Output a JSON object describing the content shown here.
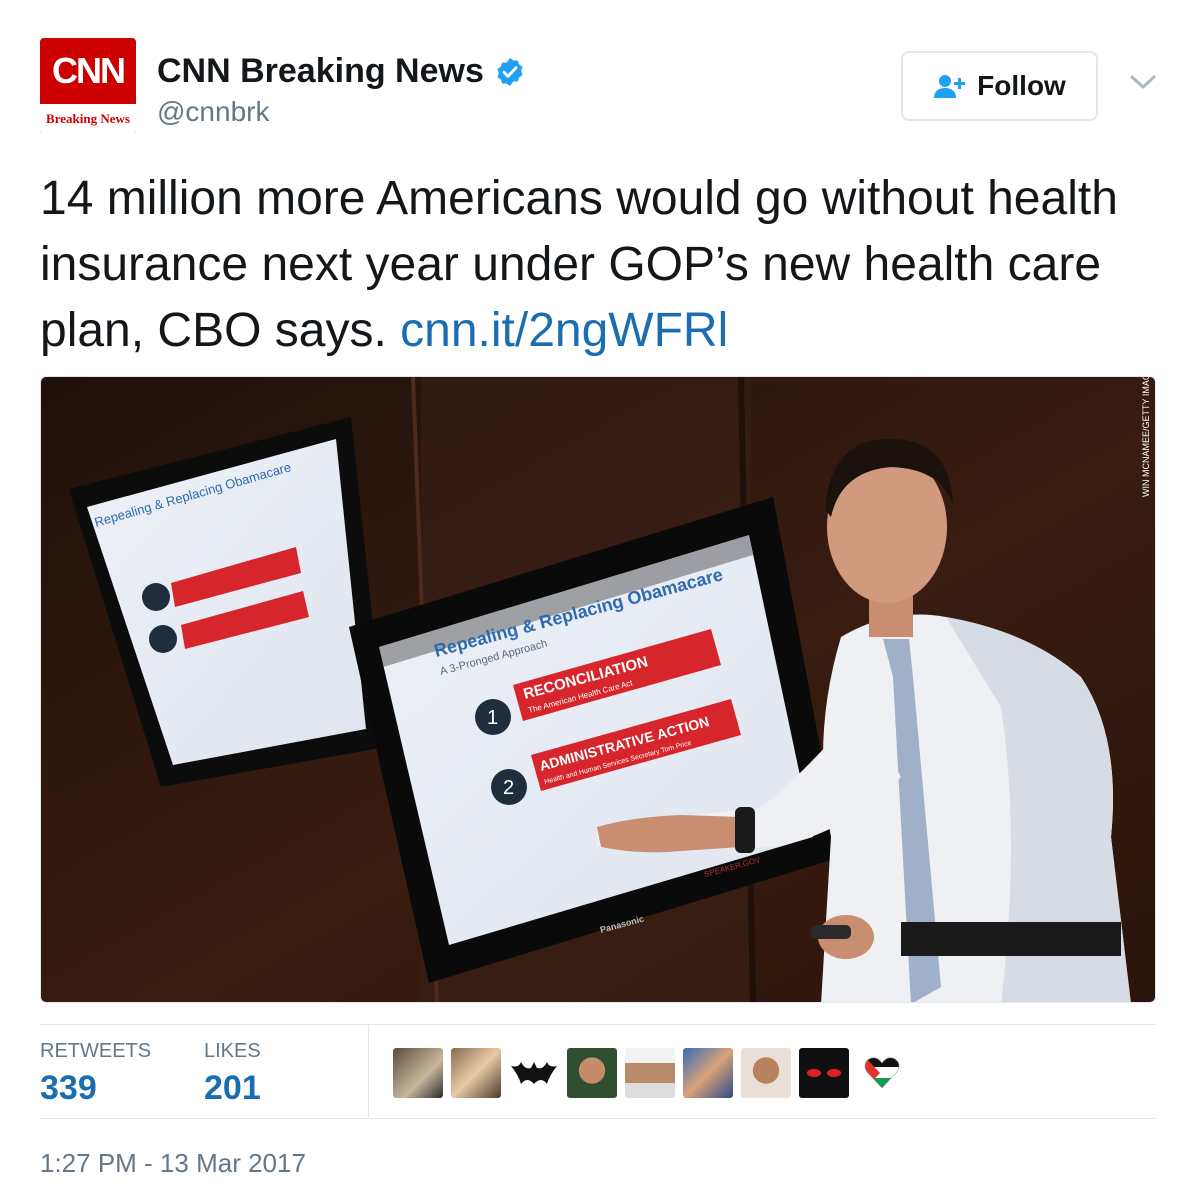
{
  "account": {
    "display_name": "CNN Breaking News",
    "handle": "@cnnbrk",
    "avatar_logo": "CNN",
    "avatar_caption": "Breaking News",
    "verified_icon": "verified-badge-icon"
  },
  "follow": {
    "label": "Follow",
    "icon": "add-user-icon"
  },
  "menu": {
    "icon": "chevron-down-icon"
  },
  "tweet": {
    "text": "14 million more Americans would go without health insurance next year under GOP’s new health care plan, CBO says. ",
    "link": "cnn.it/2ngWFRl"
  },
  "media": {
    "slide_title": "Repealing & Replacing Obamacare",
    "slide_subtitle": "A 3-Pronged Approach",
    "item1_number": "1",
    "item1_title": "RECONCILIATION",
    "item1_sub": "The American Health Care Act",
    "item2_number": "2",
    "item2_title": "ADMINISTRATIVE ACTION",
    "item2_sub": "Health and Human Services Secretary Tom Price",
    "monitor_brand": "Panasonic",
    "credit": "WIN MCNAMEE/GETTY IMAGES",
    "slide_footer": "SPEAKER.GOV"
  },
  "stats": {
    "retweets_label": "RETWEETS",
    "retweets_value": "339",
    "likes_label": "LIKES",
    "likes_value": "201"
  },
  "likers": [
    "liker-avatar-1",
    "liker-avatar-2",
    "liker-avatar-3",
    "liker-avatar-4",
    "liker-avatar-5",
    "liker-avatar-6",
    "liker-avatar-7",
    "liker-avatar-8",
    "liker-avatar-9"
  ],
  "timestamp": "1:27 PM - 13 Mar 2017",
  "colors": {
    "link": "#1b6db1",
    "cnn_red": "#cc0000",
    "muted": "#657786",
    "border": "#e1e8ed"
  }
}
